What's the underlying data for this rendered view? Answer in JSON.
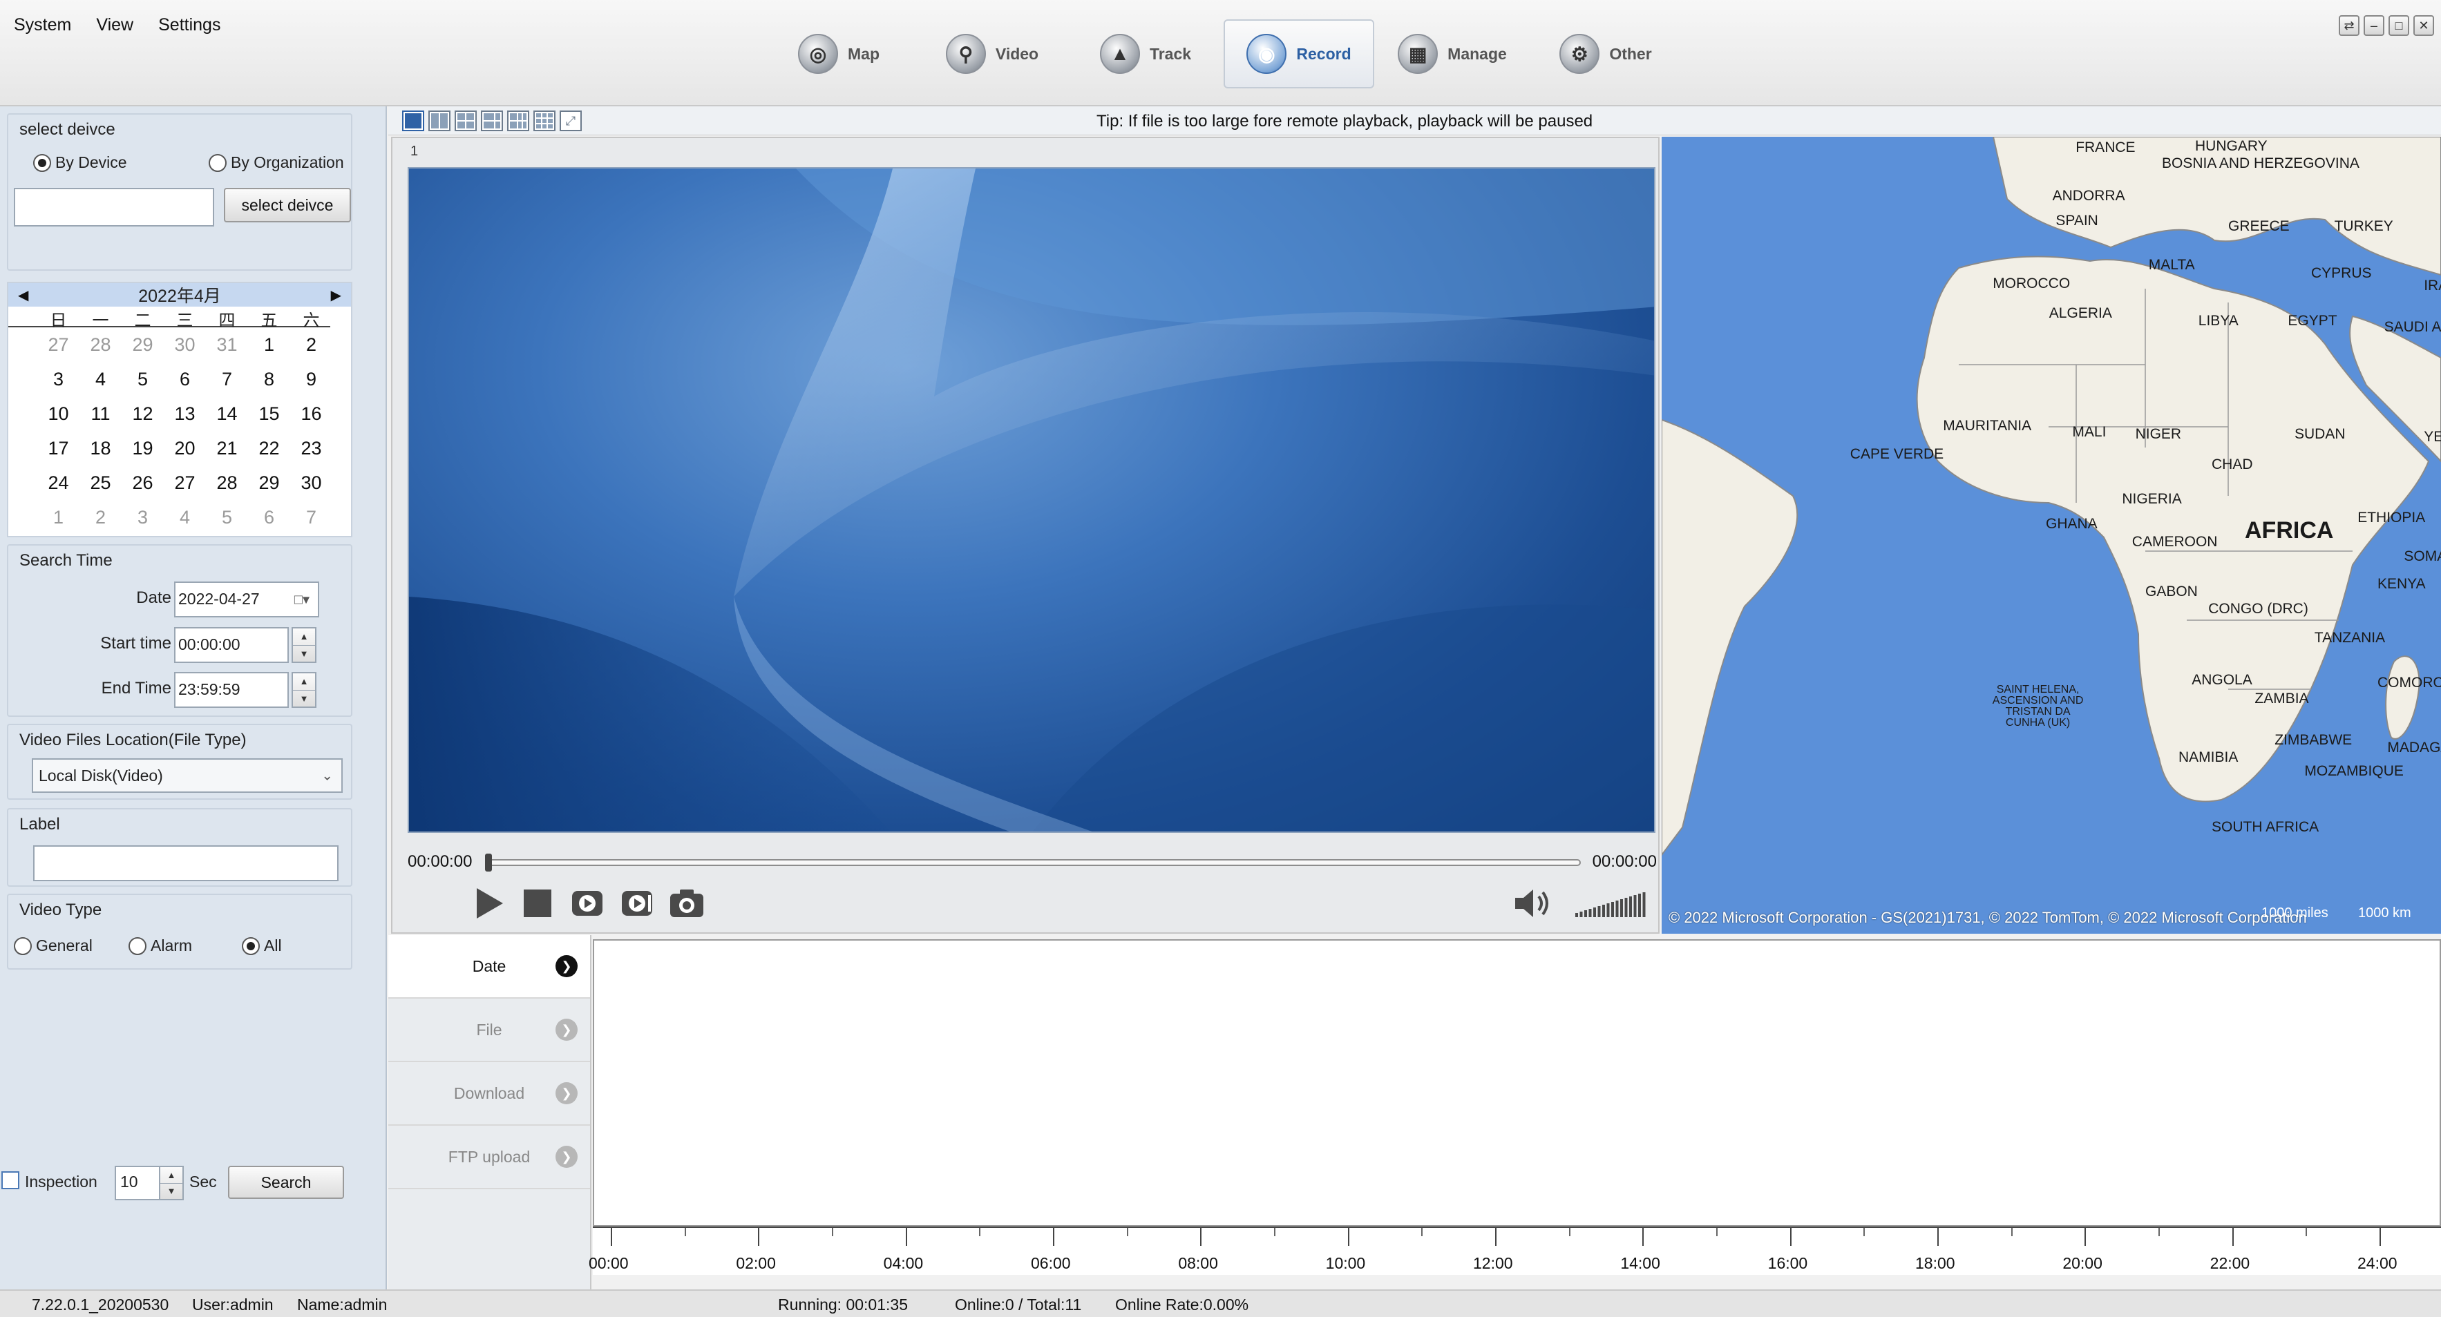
{
  "menu": {
    "system": "System",
    "view": "View",
    "settings": "Settings"
  },
  "nav": [
    {
      "label": "Map",
      "icon": "globe-icon"
    },
    {
      "label": "Video",
      "icon": "camera-icon"
    },
    {
      "label": "Track",
      "icon": "car-icon"
    },
    {
      "label": "Record",
      "icon": "record-icon"
    },
    {
      "label": "Manage",
      "icon": "manage-icon"
    },
    {
      "label": "Other",
      "icon": "other-icon"
    }
  ],
  "nav_active": "Record",
  "device": {
    "title": "select deivce",
    "by_device": "By Device",
    "by_org": "By Organization",
    "input_value": "",
    "button": "select deivce"
  },
  "calendar": {
    "title": "2022年4月",
    "weekdays": [
      "日",
      "一",
      "二",
      "三",
      "四",
      "五",
      "六"
    ],
    "days": [
      "27",
      "28",
      "29",
      "30",
      "31",
      "1",
      "2",
      "3",
      "4",
      "5",
      "6",
      "7",
      "8",
      "9",
      "10",
      "11",
      "12",
      "13",
      "14",
      "15",
      "16",
      "17",
      "18",
      "19",
      "20",
      "21",
      "22",
      "23",
      "24",
      "25",
      "26",
      "27",
      "28",
      "29",
      "30",
      "1",
      "2",
      "3",
      "4",
      "5",
      "6",
      "7"
    ]
  },
  "search_time": {
    "title": "Search Time",
    "date_label": "Date",
    "date_value": "2022-04-27",
    "start_label": "Start time",
    "start_value": "00:00:00",
    "end_label": "End Time",
    "end_value": "23:59:59"
  },
  "location": {
    "title": "Video Files Location(File Type)",
    "selected": "Local Disk(Video)"
  },
  "label": {
    "title": "Label",
    "value": ""
  },
  "video_type": {
    "title": "Video Type",
    "general": "General",
    "alarm": "Alarm",
    "all": "All"
  },
  "inspection": {
    "label": "Inspection",
    "value": "10",
    "unit": "Sec",
    "search": "Search"
  },
  "tip": "Tip: If file is too large fore remote playback, playback will be paused",
  "player": {
    "channel": "1",
    "start": "00:00:00",
    "end": "00:00:00",
    "progress_fraction": 0.0
  },
  "map": {
    "copyright": "© 2022 Microsoft Corporation - GS(2021)1731, © 2022 TomTom, © 2022 Microsoft Corporation",
    "scale_mi": "1000 miles",
    "scale_km": "1000 km",
    "labels": [
      "FRANCE",
      "HUNGARY",
      "BOSNIA AND HERZEGOVINA",
      "ANDORRA",
      "SPAIN",
      "GREECE",
      "TURKEY",
      "MALTA",
      "CYPRUS",
      "MOROCCO",
      "IRAQ",
      "ALGERIA",
      "LIBYA",
      "EGYPT",
      "SAUDI ARABIA",
      "MAURITANIA",
      "MALI",
      "NIGER",
      "CHAD",
      "SUDAN",
      "YEMEN",
      "CAPE VERDE",
      "NIGERIA",
      "GHANA",
      "CAMEROON",
      "AFRICA",
      "ETHIOPIA",
      "SOMALIA",
      "KENYA",
      "GABON",
      "CONGO (DRC)",
      "TANZANIA",
      "SAINT HELENA, ASCENSION AND TRISTAN DA CUNHA (UK)",
      "ANGOLA",
      "ZAMBIA",
      "COMOROS",
      "ZIMBABWE",
      "MADAGASCAR",
      "NAMIBIA",
      "MOZAMBIQUE",
      "SOUTH AFRICA"
    ]
  },
  "bottom_tabs": [
    "Date",
    "File",
    "Download",
    "FTP upload"
  ],
  "timeline_labels": [
    "00:00",
    "02:00",
    "04:00",
    "06:00",
    "08:00",
    "10:00",
    "12:00",
    "14:00",
    "16:00",
    "18:00",
    "20:00",
    "22:00",
    "24:00"
  ],
  "status": {
    "version": "7.22.0.1_20200530",
    "user": "User:admin",
    "name": "Name:admin",
    "running": "Running: 00:01:35",
    "online": "Online:0 / Total:11",
    "rate": "Online Rate:0.00%"
  }
}
